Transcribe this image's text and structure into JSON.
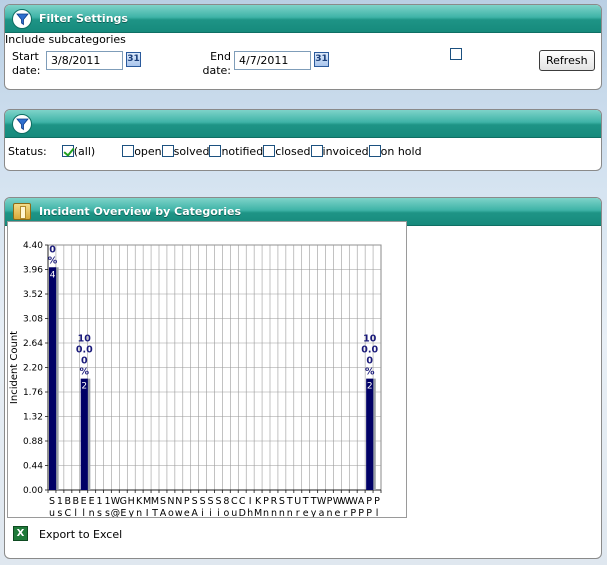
{
  "filter_settings": {
    "title": "Filter Settings",
    "start_label_1": "Start",
    "start_label_2": "date:",
    "start_value": "3/8/2011",
    "end_label_1": "End",
    "end_label_2": "date:",
    "end_value": "4/7/2011",
    "calendar_glyph": "31",
    "include_subcategories_label": "Include subcategories",
    "include_subcategories_checked": false,
    "refresh_label": "Refresh"
  },
  "status_filter": {
    "title": "",
    "label": "Status:",
    "options": [
      {
        "label": "(all)",
        "checked": true
      },
      {
        "label": "open",
        "checked": false
      },
      {
        "label": "solved",
        "checked": false
      },
      {
        "label": "notified",
        "checked": false
      },
      {
        "label": "closed",
        "checked": false
      },
      {
        "label": "invoiced",
        "checked": false
      },
      {
        "label": "on hold",
        "checked": false
      }
    ]
  },
  "overview": {
    "title": "Incident Overview by Categories",
    "export_label": "Export to Excel"
  },
  "chart_data": {
    "type": "bar",
    "ylabel": "Incident Count",
    "ylim": [
      0,
      4.4
    ],
    "yticks": [
      "0.00",
      "0.44",
      "0.88",
      "1.32",
      "1.76",
      "2.20",
      "2.64",
      "3.08",
      "3.52",
      "3.96",
      "4.40"
    ],
    "categories": [
      "Su",
      "1s",
      "BC",
      "Bl",
      "El",
      "En",
      "1s",
      "1s",
      "W@",
      "GE",
      "Hy",
      "Kn",
      "MI",
      "MT",
      "SA",
      "No",
      "Nw",
      "Pe",
      "SA",
      "Si",
      "Si",
      "Si",
      "8o",
      "Cu",
      "CD",
      "Ih",
      "KM",
      "Pn",
      "Rn",
      "Sn",
      "Tn",
      "Ur",
      "Te",
      "Ty",
      "Wa",
      "Pn",
      "We",
      "Wr",
      "WP",
      "AP",
      "PP",
      "Pl"
    ],
    "bar_colors": [
      "#000066",
      "#9aa0a6"
    ],
    "bars": [
      {
        "category_index": 0,
        "value": 4,
        "label_top": "0\n%",
        "label_in": "4"
      },
      {
        "category_index": 4,
        "value": 2,
        "label_top": "10\n0.0\n0\n%",
        "label_in": "2"
      },
      {
        "category_index": 40,
        "value": 2,
        "label_top": "10\n0.0\n0\n%",
        "label_in": "2"
      }
    ]
  }
}
